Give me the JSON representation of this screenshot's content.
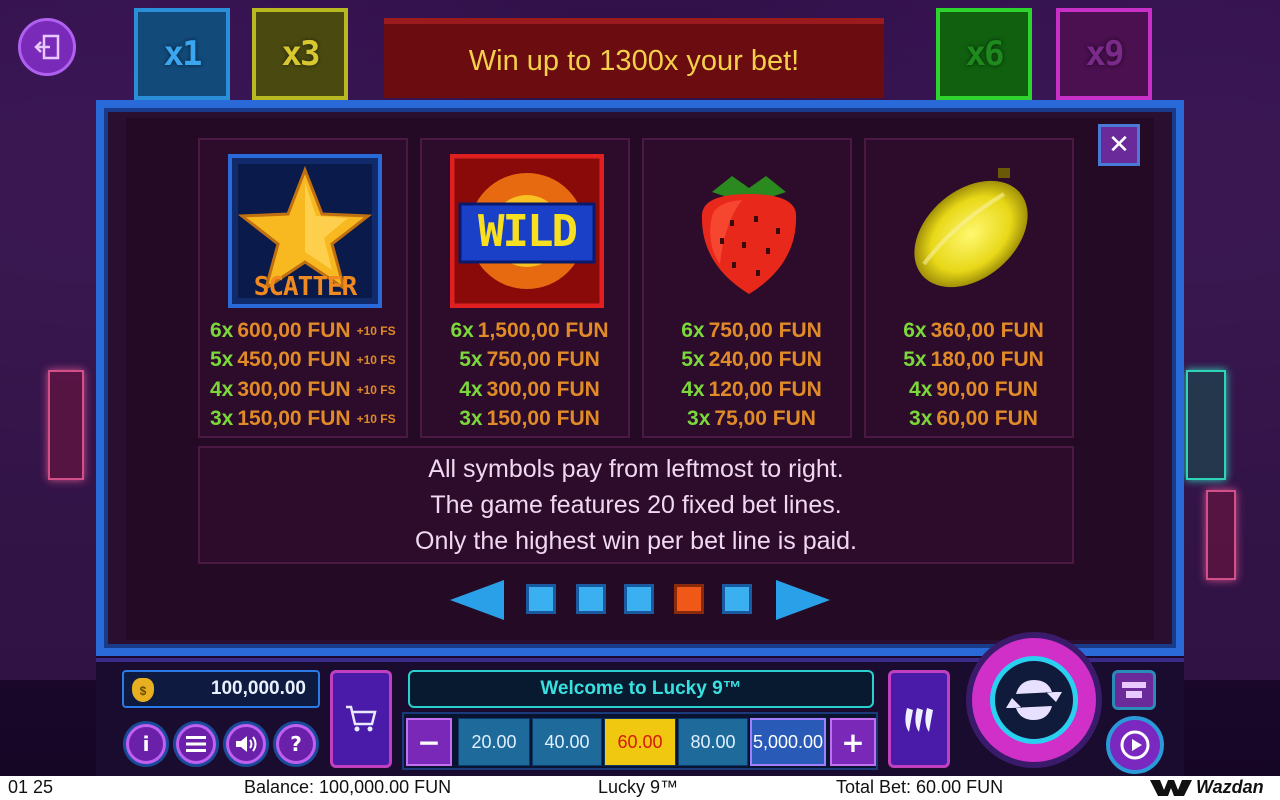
{
  "banner": {
    "text": "Win up to 1300x your bet!"
  },
  "multipliers": [
    {
      "label": "x1",
      "color": "#3aa6f0"
    },
    {
      "label": "x3",
      "color": "#d8c830"
    },
    {
      "label": "x6",
      "color": "#1e8a1e"
    },
    {
      "label": "x9",
      "color": "#7a2a88"
    }
  ],
  "symbols": [
    {
      "name": "scatter",
      "label": "SCATTER",
      "pays": [
        {
          "count": "6x",
          "amount": "600,00 FUN",
          "extra": "+10 FS"
        },
        {
          "count": "5x",
          "amount": "450,00 FUN",
          "extra": "+10 FS"
        },
        {
          "count": "4x",
          "amount": "300,00 FUN",
          "extra": "+10 FS"
        },
        {
          "count": "3x",
          "amount": "150,00 FUN",
          "extra": "+10 FS"
        }
      ]
    },
    {
      "name": "wild",
      "label": "WILD",
      "pays": [
        {
          "count": "6x",
          "amount": "1,500,00 FUN"
        },
        {
          "count": "5x",
          "amount": "750,00 FUN"
        },
        {
          "count": "4x",
          "amount": "300,00 FUN"
        },
        {
          "count": "3x",
          "amount": "150,00 FUN"
        }
      ]
    },
    {
      "name": "strawberry",
      "pays": [
        {
          "count": "6x",
          "amount": "750,00 FUN"
        },
        {
          "count": "5x",
          "amount": "240,00 FUN"
        },
        {
          "count": "4x",
          "amount": "120,00 FUN"
        },
        {
          "count": "3x",
          "amount": "75,00 FUN"
        }
      ]
    },
    {
      "name": "lemon",
      "pays": [
        {
          "count": "6x",
          "amount": "360,00 FUN"
        },
        {
          "count": "5x",
          "amount": "180,00 FUN"
        },
        {
          "count": "4x",
          "amount": "90,00 FUN"
        },
        {
          "count": "3x",
          "amount": "60,00 FUN"
        }
      ]
    }
  ],
  "info": {
    "line1": "All symbols pay from leftmost to right.",
    "line2": "The game features 20 fixed bet lines.",
    "line3": "Only the highest win per bet line is paid."
  },
  "pager": {
    "pages": 5,
    "active_page": 4
  },
  "controls": {
    "balance": "100,000.00",
    "welcome": "Welcome to Lucky 9™",
    "bets": [
      "20.00",
      "40.00",
      "60.00",
      "80.00"
    ],
    "selected_bet": "60.00",
    "max_bet": "5,000.00",
    "minus": "−",
    "plus": "+",
    "menu_icons": [
      "info-icon",
      "menu-icon",
      "sound-icon",
      "help-icon"
    ],
    "help_label": "?",
    "info_label": "i"
  },
  "status_bar": {
    "time": "01 25",
    "balance": "Balance: 100,000.00 FUN",
    "game": "Lucky 9™",
    "total_bet": "Total Bet: 60.00 FUN",
    "brand": "Wazdan"
  }
}
